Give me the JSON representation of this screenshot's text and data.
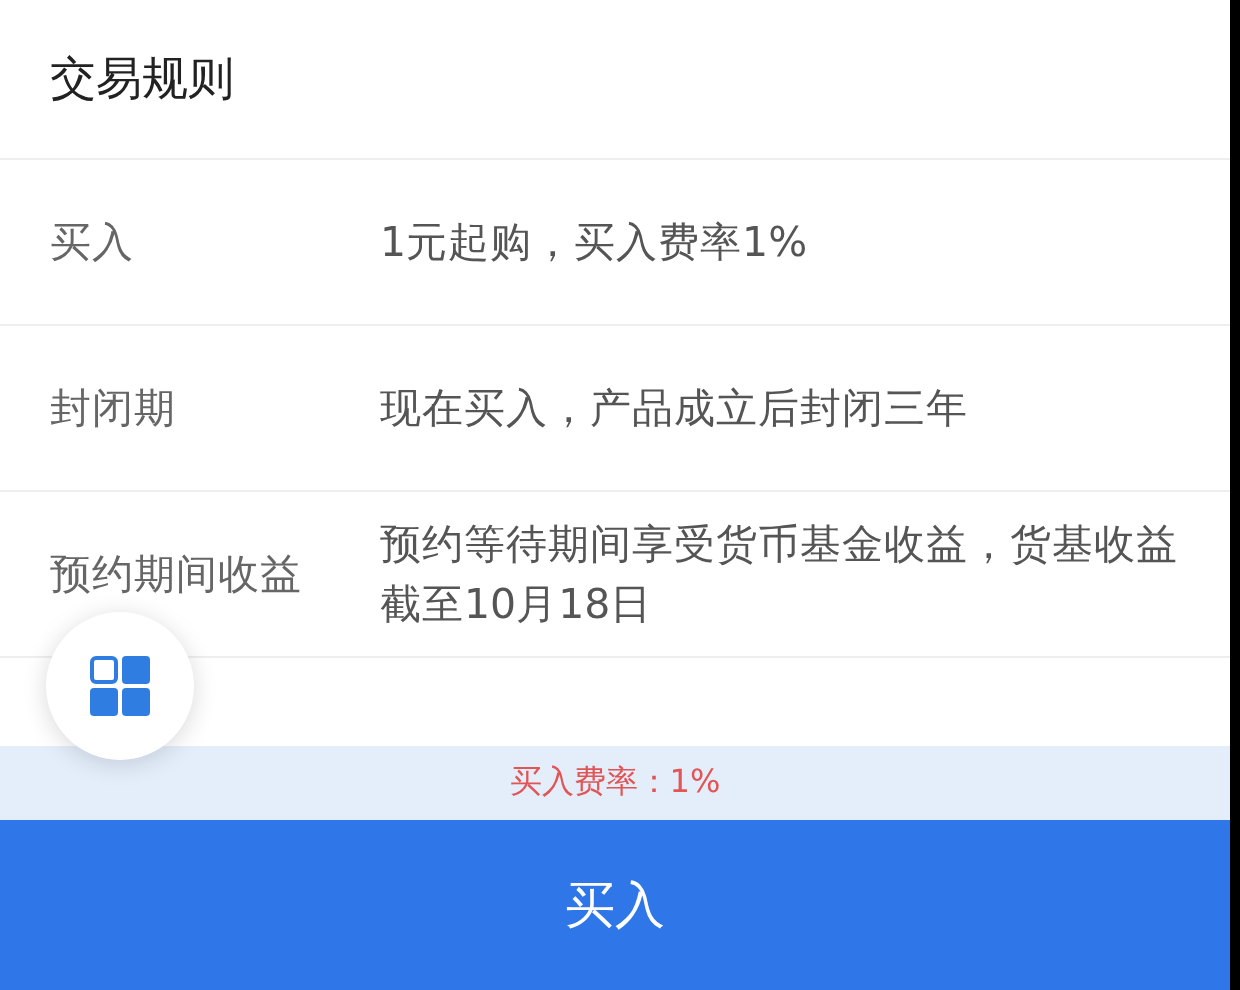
{
  "header": {
    "title": "交易规则"
  },
  "rules": [
    {
      "label": "买入",
      "value": "1元起购，买入费率1%"
    },
    {
      "label": "封闭期",
      "value": "现在买入，产品成立后封闭三年"
    },
    {
      "label": "预约期间收益",
      "value": "预约等待期间享受货币基金收益，货基收益截至10月18日"
    }
  ],
  "fee_notice": "买入费率：1%",
  "buy_button": "买入"
}
